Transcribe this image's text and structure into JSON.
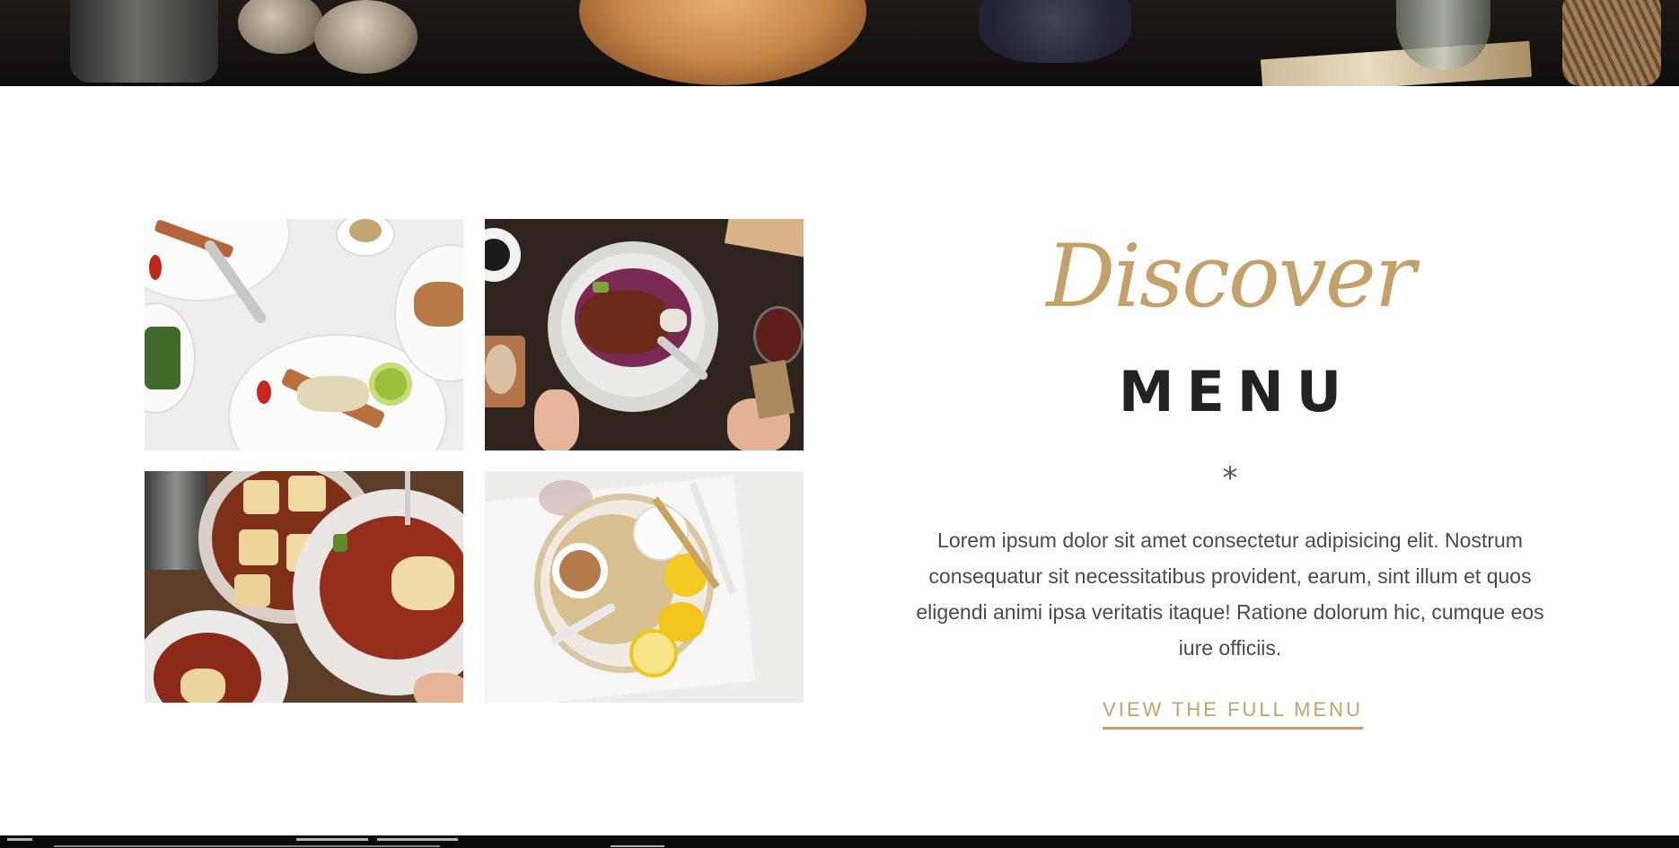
{
  "menu_section": {
    "script_heading": "Discover",
    "heading": "MENU",
    "divider": "*",
    "description": "Lorem ipsum dolor sit amet consectetur adipisicing elit. Nostrum consequatur sit necessitatibus provident, earum, sint illum et quos eligendi animi ipsa veritatis itaque! Ratione dolorum hic, cumque eos iure officiis.",
    "cta_label": "VIEW THE FULL MENU"
  },
  "gallery": {
    "images": [
      {
        "name": "salad-plates-photo"
      },
      {
        "name": "cabbage-bowl-photo"
      },
      {
        "name": "bean-stew-photo"
      },
      {
        "name": "lemon-dessert-photo"
      }
    ]
  },
  "colors": {
    "accent": "#c4a16a",
    "heading": "#222222",
    "body_text": "#4a4a4a",
    "background": "#ffffff"
  }
}
